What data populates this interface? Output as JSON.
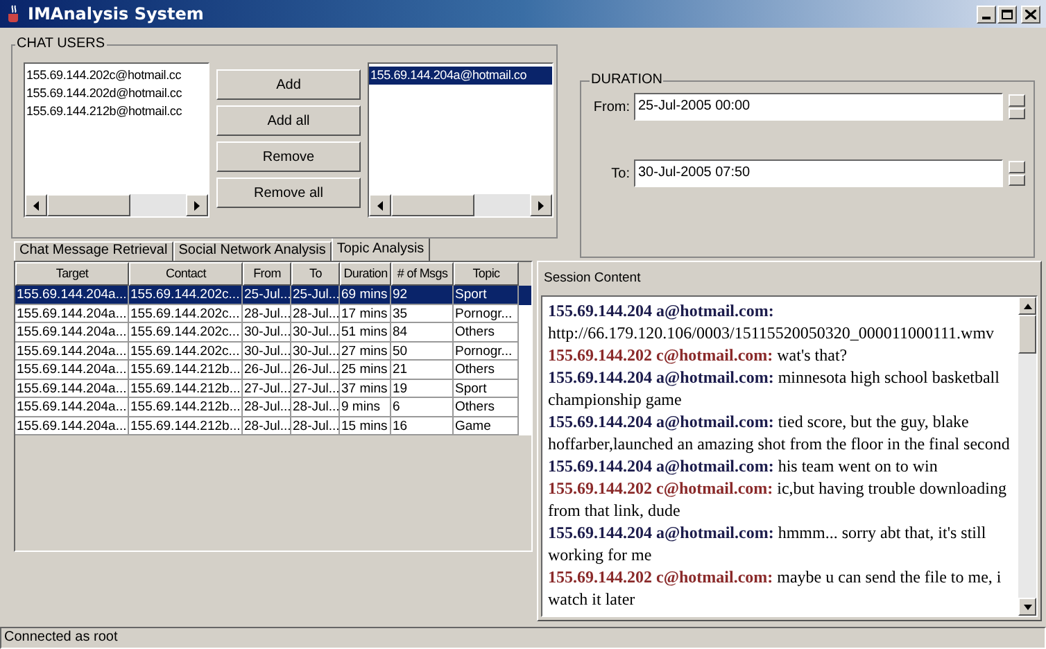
{
  "window": {
    "title": "IMAnalysis System"
  },
  "chat_users": {
    "title": "CHAT USERS",
    "available": [
      {
        "label": "155.69.144.202c@hotmail.cc",
        "selected": false
      },
      {
        "label": "155.69.144.202d@hotmail.cc",
        "selected": false
      },
      {
        "label": "155.69.144.212b@hotmail.cc",
        "selected": false
      }
    ],
    "buttons": [
      "Add",
      "Add all",
      "Remove",
      "Remove all"
    ],
    "chosen": [
      {
        "label": "155.69.144.204a@hotmail.co",
        "selected": true
      }
    ]
  },
  "duration": {
    "title": "DURATION",
    "from_label": "From:",
    "from_value": "25-Jul-2005 00:00",
    "to_label": "To:",
    "to_value": "30-Jul-2005 07:50"
  },
  "tabs": [
    {
      "label": "Chat Message Retrieval",
      "selected": false
    },
    {
      "label": "Social Network Analysis",
      "selected": false
    },
    {
      "label": "Topic Analysis",
      "selected": true
    }
  ],
  "table": {
    "columns": [
      "Target",
      "Contact",
      "From",
      "To",
      "Duration",
      "# of Msgs",
      "Topic"
    ],
    "rows": [
      {
        "selected": true,
        "cells": [
          "155.69.144.204a...",
          "155.69.144.202c...",
          "25-Jul...",
          "25-Jul...",
          "69 mins",
          "92",
          "Sport"
        ]
      },
      {
        "selected": false,
        "cells": [
          "155.69.144.204a...",
          "155.69.144.202c...",
          "28-Jul...",
          "28-Jul...",
          "17 mins",
          "35",
          "Pornogr..."
        ]
      },
      {
        "selected": false,
        "cells": [
          "155.69.144.204a...",
          "155.69.144.202c...",
          "30-Jul...",
          "30-Jul...",
          "51 mins",
          "84",
          "Others"
        ]
      },
      {
        "selected": false,
        "cells": [
          "155.69.144.204a...",
          "155.69.144.202c...",
          "30-Jul...",
          "30-Jul...",
          "27 mins",
          "50",
          "Pornogr..."
        ]
      },
      {
        "selected": false,
        "cells": [
          "155.69.144.204a...",
          "155.69.144.212b...",
          "26-Jul...",
          "26-Jul...",
          "25 mins",
          "21",
          "Others"
        ]
      },
      {
        "selected": false,
        "cells": [
          "155.69.144.204a...",
          "155.69.144.212b...",
          "27-Jul...",
          "27-Jul...",
          "37 mins",
          "19",
          "Sport"
        ]
      },
      {
        "selected": false,
        "cells": [
          "155.69.144.204a...",
          "155.69.144.212b...",
          "28-Jul...",
          "28-Jul...",
          "9 mins",
          "6",
          "Others"
        ]
      },
      {
        "selected": false,
        "cells": [
          "155.69.144.204a...",
          "155.69.144.212b...",
          "28-Jul...",
          "28-Jul...",
          "15 mins",
          "16",
          "Game"
        ]
      }
    ]
  },
  "session": {
    "title": "Session Content",
    "messages": [
      {
        "sender": "155.69.144.204 a@hotmail.com:",
        "color": "#1c1c4c",
        "text": "http://66.179.120.106/0003/15115520050320_000011000111.wmv"
      },
      {
        "sender": "155.69.144.202 c@hotmail.com:",
        "color": "#8a2a2a",
        "text": "wat's that?"
      },
      {
        "sender": "155.69.144.204 a@hotmail.com:",
        "color": "#1c1c4c",
        "text": "minnesota high school basketball championship game"
      },
      {
        "sender": "155.69.144.204 a@hotmail.com:",
        "color": "#1c1c4c",
        "text": "tied score, but the guy, blake hoffarber,launched an amazing shot from the floor in the final second"
      },
      {
        "sender": "155.69.144.204 a@hotmail.com:",
        "color": "#1c1c4c",
        "text": "his team went on to win"
      },
      {
        "sender": "155.69.144.202 c@hotmail.com:",
        "color": "#8a2a2a",
        "text": "ic,but having trouble downloading from that link, dude"
      },
      {
        "sender": "155.69.144.204 a@hotmail.com:",
        "color": "#1c1c4c",
        "text": "hmmm... sorry abt that, it's still working for me"
      },
      {
        "sender": "155.69.144.202 c@hotmail.com:",
        "color": "#8a2a2a",
        "text": "maybe u can send the file to me, i watch it later"
      }
    ]
  },
  "status_bar": "Connected as root"
}
